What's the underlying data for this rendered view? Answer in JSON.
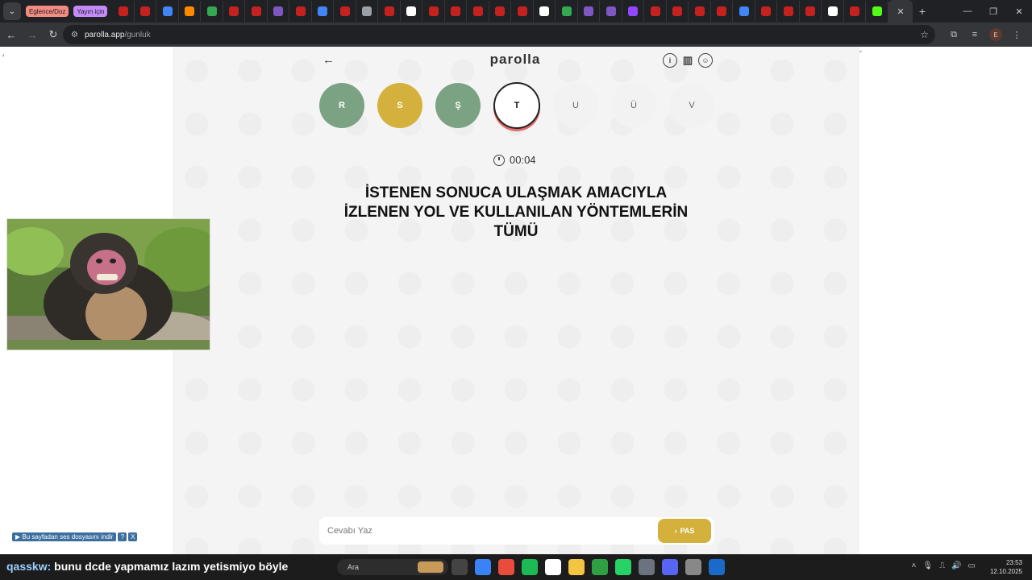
{
  "browser": {
    "tab_groups": [
      {
        "label": "Eglence/Doz",
        "color": "#f28b82"
      },
      {
        "label": "Yayın için",
        "color": "#c58af9"
      }
    ],
    "tab_icon_colors": [
      "#c5221f",
      "#c5221f",
      "#4285f4",
      "#ff8a00",
      "#34a853",
      "#c5221f",
      "#c5221f",
      "#7e57c2",
      "#c5221f",
      "#4285f4",
      "#c5221f",
      "#9aa0a6",
      "#c5221f",
      "#ffffff",
      "#c5221f",
      "#c5221f",
      "#c5221f",
      "#c5221f",
      "#c5221f",
      "#ffffff",
      "#34a853",
      "#7e57c2",
      "#7e57c2",
      "#9146ff",
      "#c5221f",
      "#c5221f",
      "#c5221f",
      "#c5221f",
      "#4285f4",
      "#c5221f",
      "#c5221f",
      "#c5221f",
      "#ffffff",
      "#c5221f",
      "#53fc18"
    ],
    "active_tab_close": "✕",
    "new_tab": "+",
    "window_controls": {
      "minimize": "—",
      "restore": "❐",
      "close": "✕"
    },
    "url_host": "parolla.app",
    "url_path": "/gunluk",
    "profile_initial": "E"
  },
  "game": {
    "logo": "parolla",
    "letters": [
      {
        "char": "R",
        "state": "correct"
      },
      {
        "char": "S",
        "state": "passed"
      },
      {
        "char": "Ş",
        "state": "correct"
      },
      {
        "char": "T",
        "state": "current"
      },
      {
        "char": "U",
        "state": "pending"
      },
      {
        "char": "Ü",
        "state": "pending"
      },
      {
        "char": "V",
        "state": "pending"
      }
    ],
    "timer": "00:04",
    "question": "İSTENEN SONUCA ULAŞMAK AMACIYLA İZLENEN YOL VE KULLANILAN YÖNTEMLERİN TÜMÜ",
    "answer_placeholder": "Cevabı Yaz",
    "pass_label": "PAS",
    "colors": {
      "correct": "#7ba383",
      "passed": "#d4b13c",
      "current_ring": "#e06b6b"
    }
  },
  "overlay": {
    "sound_download_label": "▶ Bu sayfadan ses dosyasını indir",
    "sound_help": "?",
    "sound_close": "X"
  },
  "taskbar": {
    "chat_user": "qasskw:",
    "chat_message": "bunu dcde yapmamız lazım yetismiyo böyle",
    "search_label": "Ara",
    "time": "23:53",
    "date": "12.10.2025",
    "app_colors": [
      "#444",
      "#3b82f6",
      "#e84c3d",
      "#1db954",
      "#ffffff",
      "#f4c542",
      "#2ea043",
      "#25d366",
      "#6b7280",
      "#5865f2",
      "#888",
      "#1b6ac9"
    ]
  }
}
